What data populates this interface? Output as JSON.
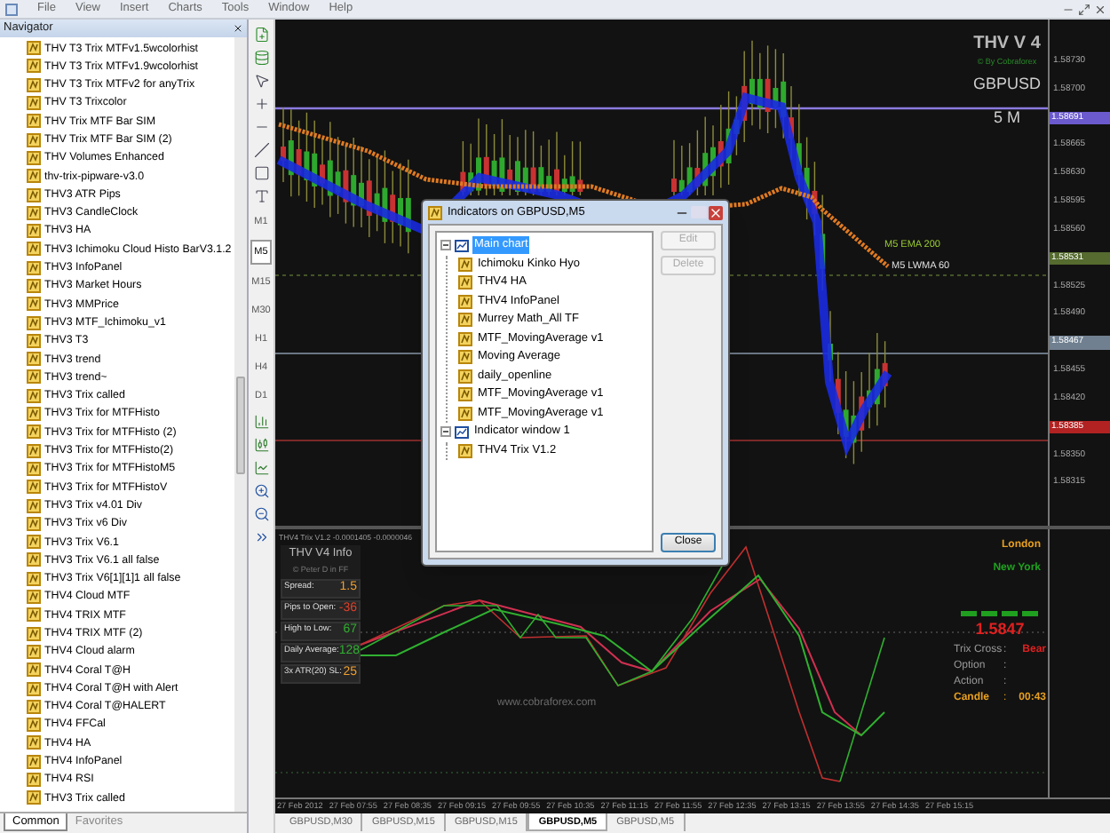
{
  "menu": [
    "File",
    "View",
    "Insert",
    "Charts",
    "Tools",
    "Window",
    "Help"
  ],
  "navigator": {
    "title": "Navigator",
    "items": [
      "THV T3 Trix MTFv1.5wcolorhist",
      "THV T3 Trix MTFv1.9wcolorhist",
      "THV T3 Trix MTFv2 for anyTrix",
      "THV T3 Trixcolor",
      "THV Trix MTF Bar SIM",
      "THV Trix MTF Bar SIM (2)",
      "THV Volumes Enhanced",
      "thv-trix-pipware-v3.0",
      "THV3 ATR Pips",
      "THV3 CandleClock",
      "THV3 HA",
      "THV3 Ichimoku Cloud Histo BarV3.1.2",
      "THV3 InfoPanel",
      "THV3 Market Hours",
      "THV3 MMPrice",
      "THV3 MTF_Ichimoku_v1",
      "THV3 T3",
      "THV3 trend",
      "THV3 trend~",
      "THV3 Trix called",
      "THV3 Trix for MTFHisto",
      "THV3 Trix for MTFHisto (2)",
      "THV3 Trix for MTFHisto(2)",
      "THV3 Trix for MTFHistoM5",
      "THV3 Trix for MTFHistoV",
      "THV3 Trix v4.01 Div",
      "THV3 Trix v6 Div",
      "THV3 Trix V6.1",
      "THV3 Trix V6.1 all false",
      "THV3 Trix V6[1][1]1 all false",
      "THV4  Cloud MTF",
      "THV4  TRIX MTF",
      "THV4  TRIX MTF (2)",
      "THV4 Cloud alarm",
      "THV4 Coral  T@H",
      "THV4 Coral  T@H with Alert",
      "THV4 Coral  T@HALERT",
      "THV4 FFCal",
      "THV4 HA",
      "THV4 InfoPanel",
      "THV4 RSI",
      "THV3 Trix called"
    ],
    "tabs": [
      {
        "label": "Common",
        "selected": true
      },
      {
        "label": "Favorites",
        "selected": false
      }
    ]
  },
  "timeframes": [
    {
      "label": "M1",
      "selected": false
    },
    {
      "label": "M5",
      "selected": true
    },
    {
      "label": "M15",
      "selected": false
    },
    {
      "label": "M30",
      "selected": false
    },
    {
      "label": "H1",
      "selected": false
    },
    {
      "label": "H4",
      "selected": false
    },
    {
      "label": "D1",
      "selected": false
    }
  ],
  "chart": {
    "title": "THV V 4",
    "credit": "© By Cobraforex",
    "symbol": "GBPUSD",
    "period": "5 M",
    "ma_labels": [
      {
        "text": "M5 EMA 200",
        "color": "#9acd32"
      },
      {
        "text": "M5 LWMA 60",
        "color": "#e0e0e0"
      }
    ],
    "price_axis": [
      {
        "text": "1.58730",
        "kind": "tick"
      },
      {
        "text": "1.58700",
        "kind": "tick"
      },
      {
        "text": "1.58691",
        "kind": "marker",
        "color": "#6a5acd"
      },
      {
        "text": "1.58665",
        "kind": "tick"
      },
      {
        "text": "1.58630",
        "kind": "tick"
      },
      {
        "text": "1.58595",
        "kind": "tick"
      },
      {
        "text": "1.58560",
        "kind": "tick"
      },
      {
        "text": "1.58531",
        "kind": "marker",
        "color": "#556b2f"
      },
      {
        "text": "1.58525",
        "kind": "tick"
      },
      {
        "text": "1.58490",
        "kind": "tick"
      },
      {
        "text": "1.58467",
        "kind": "marker",
        "color": "#708090"
      },
      {
        "text": "1.58455",
        "kind": "tick"
      },
      {
        "text": "1.58420",
        "kind": "tick"
      },
      {
        "text": "1.58385",
        "kind": "marker",
        "color": "#b22222"
      },
      {
        "text": "1.58350",
        "kind": "tick"
      },
      {
        "text": "1.58315",
        "kind": "tick"
      }
    ],
    "indicator": {
      "label": "THV4 Trix V1.2 -0.0001405 -0.0000046",
      "info": {
        "title": "THV  V4 Info",
        "credit": "© Peter D in FF",
        "rows": [
          {
            "label": "Spread:",
            "value": "1.5",
            "color": "#f0a030"
          },
          {
            "label": "Pips to Open:",
            "value": "-36",
            "color": "#e0402a"
          },
          {
            "label": "High to Low:",
            "value": "67",
            "color": "#30b030"
          },
          {
            "label": "Daily Average:",
            "value": "128",
            "color": "#30b030"
          },
          {
            "label": "3x ATR(20) SL:",
            "value": "25",
            "color": "#f0a030"
          }
        ]
      },
      "sessions": [
        {
          "label": "London",
          "color": "#e8a020"
        },
        {
          "label": "New York",
          "color": "#20a020"
        }
      ],
      "price": "1.5847",
      "status_rows": [
        {
          "label": "Trix Cross",
          "separator": ":",
          "value": "Bear",
          "kind": "plain",
          "color": "#e02020"
        },
        {
          "label": "Option",
          "separator": ":",
          "kind": "plain"
        },
        {
          "label": "Action",
          "separator": ":",
          "kind": "plain"
        },
        {
          "label": "Candle",
          "separator": ":",
          "value": "00:43",
          "kind": "accent",
          "color": "#e8a020"
        }
      ],
      "site": "www.cobraforex.com"
    },
    "time_axis": [
      "27 Feb 2012",
      "27 Feb 07:55",
      "27 Feb 08:35",
      "27 Feb 09:15",
      "27 Feb 09:55",
      "27 Feb 10:35",
      "27 Feb 11:15",
      "27 Feb 11:55",
      "27 Feb 12:35",
      "27 Feb 13:15",
      "27 Feb 13:55",
      "27 Feb 14:35",
      "27 Feb 15:15"
    ]
  },
  "chart_tabs": [
    {
      "label": "GBPUSD,M30",
      "selected": false
    },
    {
      "label": "GBPUSD,M15",
      "selected": false
    },
    {
      "label": "GBPUSD,M15",
      "selected": false
    },
    {
      "label": "GBPUSD,M5",
      "selected": true
    },
    {
      "label": "GBPUSD,M5",
      "selected": false
    }
  ],
  "dialog": {
    "title": "Indicators on GBPUSD,M5",
    "tree": [
      {
        "label": "Main chart",
        "selected": true,
        "expanded": true,
        "children": [
          {
            "label": "Ichimoku Kinko Hyo",
            "selected": false
          },
          {
            "label": "THV4 HA",
            "selected": false
          },
          {
            "label": "THV4 InfoPanel",
            "selected": false
          },
          {
            "label": "Murrey Math_All TF",
            "selected": false
          },
          {
            "label": "MTF_MovingAverage v1",
            "selected": false
          },
          {
            "label": "Moving Average",
            "selected": false
          },
          {
            "label": "daily_openline",
            "selected": false
          },
          {
            "label": "MTF_MovingAverage v1",
            "selected": false
          },
          {
            "label": "MTF_MovingAverage v1",
            "selected": false
          }
        ]
      },
      {
        "label": "Indicator window 1",
        "selected": false,
        "expanded": true,
        "children": [
          {
            "label": "THV4 Trix V1.2",
            "selected": false
          }
        ]
      }
    ],
    "buttons": [
      {
        "label": "Edit",
        "disabled": true
      },
      {
        "label": "Delete",
        "disabled": true
      },
      {
        "label": "Close",
        "disabled": false
      }
    ]
  }
}
